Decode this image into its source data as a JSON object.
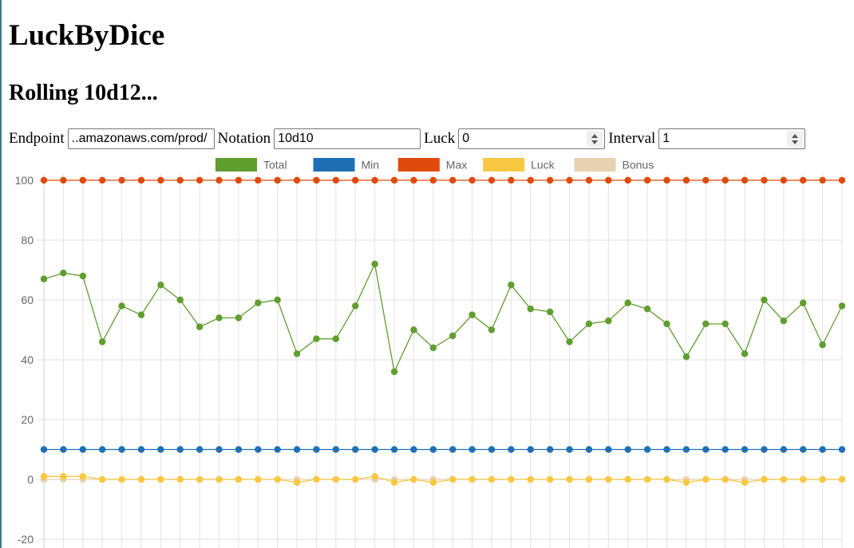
{
  "app": {
    "title": "LuckByDice",
    "subtitle": "Rolling 10d12..."
  },
  "controls": {
    "endpoint_label": "Endpoint",
    "endpoint_value": "..amazonaws.com/prod/",
    "notation_label": "Notation",
    "notation_value": "10d10",
    "luck_label": "Luck",
    "luck_value": "0",
    "interval_label": "Interval",
    "interval_value": "1"
  },
  "chart_data": {
    "type": "line",
    "ylim": [
      -20,
      100
    ],
    "yticks": [
      -20,
      0,
      20,
      40,
      60,
      80,
      100
    ],
    "grid": true,
    "legend_position": "top",
    "num_points": 42,
    "series": [
      {
        "name": "Total",
        "color": "#5f9e2f",
        "values": [
          67,
          69,
          68,
          46,
          58,
          55,
          65,
          60,
          51,
          54,
          54,
          59,
          60,
          42,
          47,
          47,
          58,
          72,
          36,
          50,
          44,
          48,
          55,
          50,
          65,
          57,
          56,
          46,
          52,
          53,
          59,
          57,
          52,
          41,
          52,
          52,
          42,
          60,
          53,
          59,
          45,
          58
        ]
      },
      {
        "name": "Min",
        "color": "#1f6fb5",
        "values": [
          10,
          10,
          10,
          10,
          10,
          10,
          10,
          10,
          10,
          10,
          10,
          10,
          10,
          10,
          10,
          10,
          10,
          10,
          10,
          10,
          10,
          10,
          10,
          10,
          10,
          10,
          10,
          10,
          10,
          10,
          10,
          10,
          10,
          10,
          10,
          10,
          10,
          10,
          10,
          10,
          10,
          10
        ]
      },
      {
        "name": "Max",
        "color": "#e04a0c",
        "values": [
          100,
          100,
          100,
          100,
          100,
          100,
          100,
          100,
          100,
          100,
          100,
          100,
          100,
          100,
          100,
          100,
          100,
          100,
          100,
          100,
          100,
          100,
          100,
          100,
          100,
          100,
          100,
          100,
          100,
          100,
          100,
          100,
          100,
          100,
          100,
          100,
          100,
          100,
          100,
          100,
          100,
          100
        ]
      },
      {
        "name": "Luck",
        "color": "#f9c843",
        "values": [
          1,
          1,
          1,
          0,
          0,
          0,
          0,
          0,
          0,
          0,
          0,
          0,
          0,
          -1,
          0,
          0,
          0,
          1,
          -1,
          0,
          -1,
          0,
          0,
          0,
          0,
          0,
          0,
          0,
          0,
          0,
          0,
          0,
          0,
          -1,
          0,
          0,
          -1,
          0,
          0,
          0,
          0,
          0
        ]
      },
      {
        "name": "Bonus",
        "color": "#e8d2b2",
        "values": [
          0,
          0,
          0,
          0,
          0,
          0,
          0,
          0,
          0,
          0,
          0,
          0,
          0,
          0,
          0,
          0,
          0,
          0,
          0,
          0,
          0,
          0,
          0,
          0,
          0,
          0,
          0,
          0,
          0,
          0,
          0,
          0,
          0,
          0,
          0,
          0,
          0,
          0,
          0,
          0,
          0,
          0
        ]
      }
    ]
  }
}
